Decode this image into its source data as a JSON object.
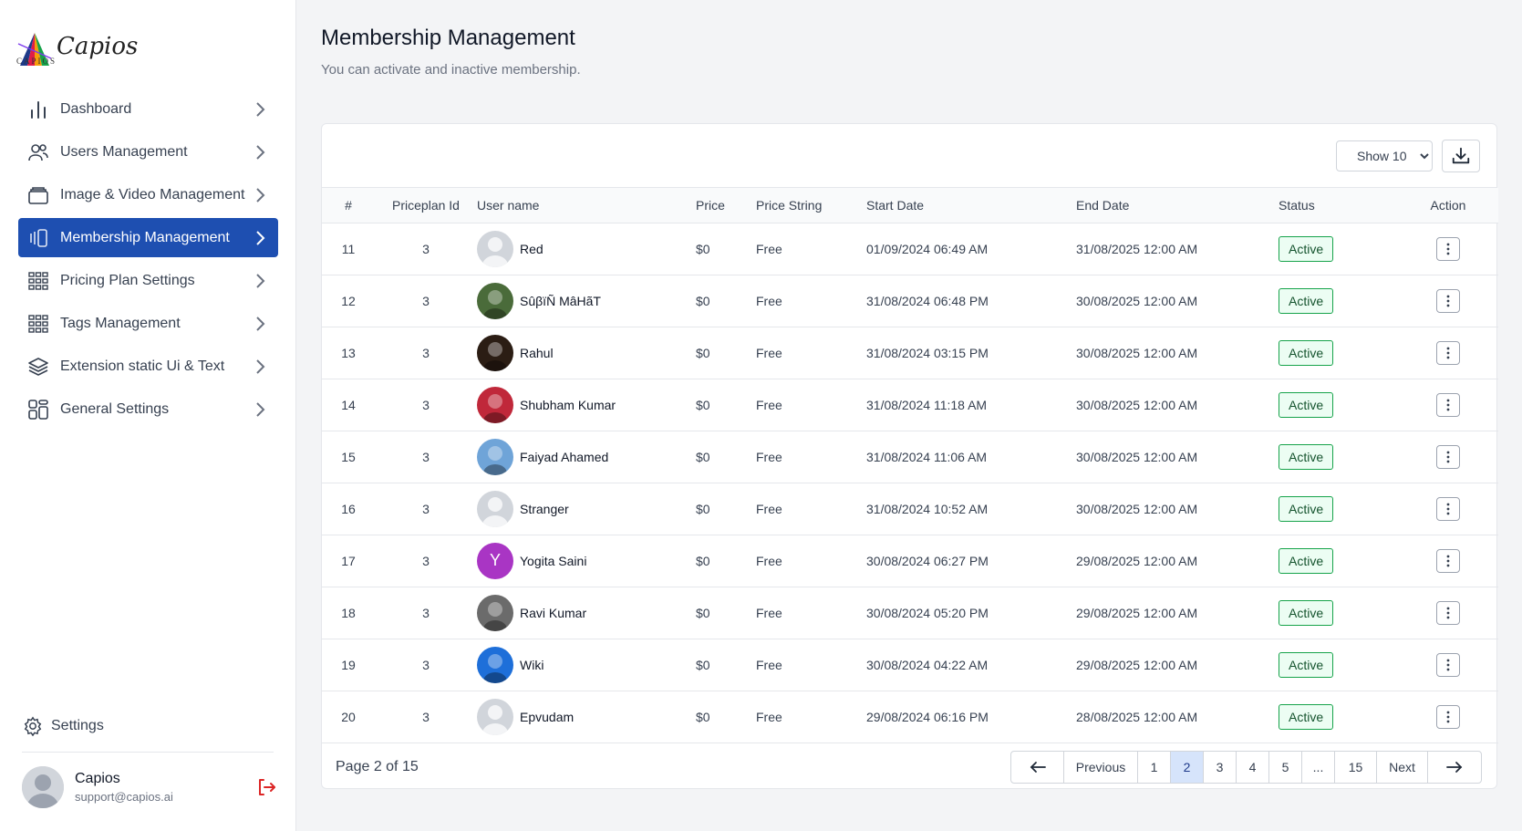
{
  "brand": {
    "name": "Capios",
    "caption": "CAPIOS"
  },
  "sidebar": {
    "items": [
      {
        "label": "Dashboard",
        "icon": "bar-chart-icon"
      },
      {
        "label": "Users Management",
        "icon": "users-icon"
      },
      {
        "label": "Image & Video Management",
        "icon": "folder-stack-icon"
      },
      {
        "label": "Membership Management",
        "icon": "cards-icon",
        "active": true
      },
      {
        "label": "Pricing Plan Settings",
        "icon": "grid-icon"
      },
      {
        "label": "Tags Management",
        "icon": "grid-icon"
      },
      {
        "label": "Extension static Ui & Text",
        "icon": "layers-icon"
      },
      {
        "label": "General Settings",
        "icon": "apps-icon"
      }
    ],
    "settings_label": "Settings",
    "user": {
      "name": "Capios",
      "email": "support@capios.ai"
    }
  },
  "header": {
    "title": "Membership Management",
    "subtitle": "You can activate and inactive membership."
  },
  "toolbar": {
    "show_label": "Show 10",
    "show_options": [
      "Show 10"
    ]
  },
  "table": {
    "columns": [
      "#",
      "Priceplan Id",
      "User name",
      "Price",
      "Price String",
      "Start Date",
      "End Date",
      "Status",
      "Action"
    ],
    "rows": [
      {
        "num": "11",
        "pp": "3",
        "user": "Red",
        "price": "$0",
        "pstr": "Free",
        "start": "01/09/2024 06:49 AM",
        "end": "31/08/2025 12:00 AM",
        "status": "Active"
      },
      {
        "num": "12",
        "pp": "3",
        "user": "SûβïÑ MâHãT",
        "price": "$0",
        "pstr": "Free",
        "start": "31/08/2024 06:48 PM",
        "end": "30/08/2025 12:00 AM",
        "status": "Active"
      },
      {
        "num": "13",
        "pp": "3",
        "user": "Rahul",
        "price": "$0",
        "pstr": "Free",
        "start": "31/08/2024 03:15 PM",
        "end": "30/08/2025 12:00 AM",
        "status": "Active"
      },
      {
        "num": "14",
        "pp": "3",
        "user": "Shubham Kumar",
        "price": "$0",
        "pstr": "Free",
        "start": "31/08/2024 11:18 AM",
        "end": "30/08/2025 12:00 AM",
        "status": "Active"
      },
      {
        "num": "15",
        "pp": "3",
        "user": "Faiyad Ahamed",
        "price": "$0",
        "pstr": "Free",
        "start": "31/08/2024 11:06 AM",
        "end": "30/08/2025 12:00 AM",
        "status": "Active"
      },
      {
        "num": "16",
        "pp": "3",
        "user": "Stranger",
        "price": "$0",
        "pstr": "Free",
        "start": "31/08/2024 10:52 AM",
        "end": "30/08/2025 12:00 AM",
        "status": "Active"
      },
      {
        "num": "17",
        "pp": "3",
        "user": "Yogita Saini",
        "price": "$0",
        "pstr": "Free",
        "start": "30/08/2024 06:27 PM",
        "end": "29/08/2025 12:00 AM",
        "status": "Active"
      },
      {
        "num": "18",
        "pp": "3",
        "user": "Ravi Kumar",
        "price": "$0",
        "pstr": "Free",
        "start": "30/08/2024 05:20 PM",
        "end": "29/08/2025 12:00 AM",
        "status": "Active"
      },
      {
        "num": "19",
        "pp": "3",
        "user": "Wiki",
        "price": "$0",
        "pstr": "Free",
        "start": "30/08/2024 04:22 AM",
        "end": "29/08/2025 12:00 AM",
        "status": "Active"
      },
      {
        "num": "20",
        "pp": "3",
        "user": "Epvudam",
        "price": "$0",
        "pstr": "Free",
        "start": "29/08/2024 06:16 PM",
        "end": "28/08/2025 12:00 AM",
        "status": "Active"
      }
    ],
    "avatars": [
      {
        "type": "placeholder"
      },
      {
        "type": "photo",
        "color": "#4a6b3a"
      },
      {
        "type": "photo",
        "color": "#2b1d14"
      },
      {
        "type": "photo",
        "color": "#c0283a"
      },
      {
        "type": "photo",
        "color": "#6fa4d8"
      },
      {
        "type": "placeholder"
      },
      {
        "type": "letter",
        "letter": "Y",
        "color": "#a935c4"
      },
      {
        "type": "photo",
        "color": "#6b6b6b"
      },
      {
        "type": "photo",
        "color": "#1e6fd9"
      },
      {
        "type": "placeholder"
      }
    ]
  },
  "footer": {
    "page_info": "Page 2 of 15",
    "pagination": [
      "Previous",
      "1",
      "2",
      "3",
      "4",
      "5",
      "...",
      "15",
      "Next"
    ],
    "active_page": "2"
  },
  "colors": {
    "accent": "#1e4fb1",
    "status_active_border": "#16a34a",
    "status_active_bg": "#ecfdf3",
    "logout": "#dc2626"
  }
}
